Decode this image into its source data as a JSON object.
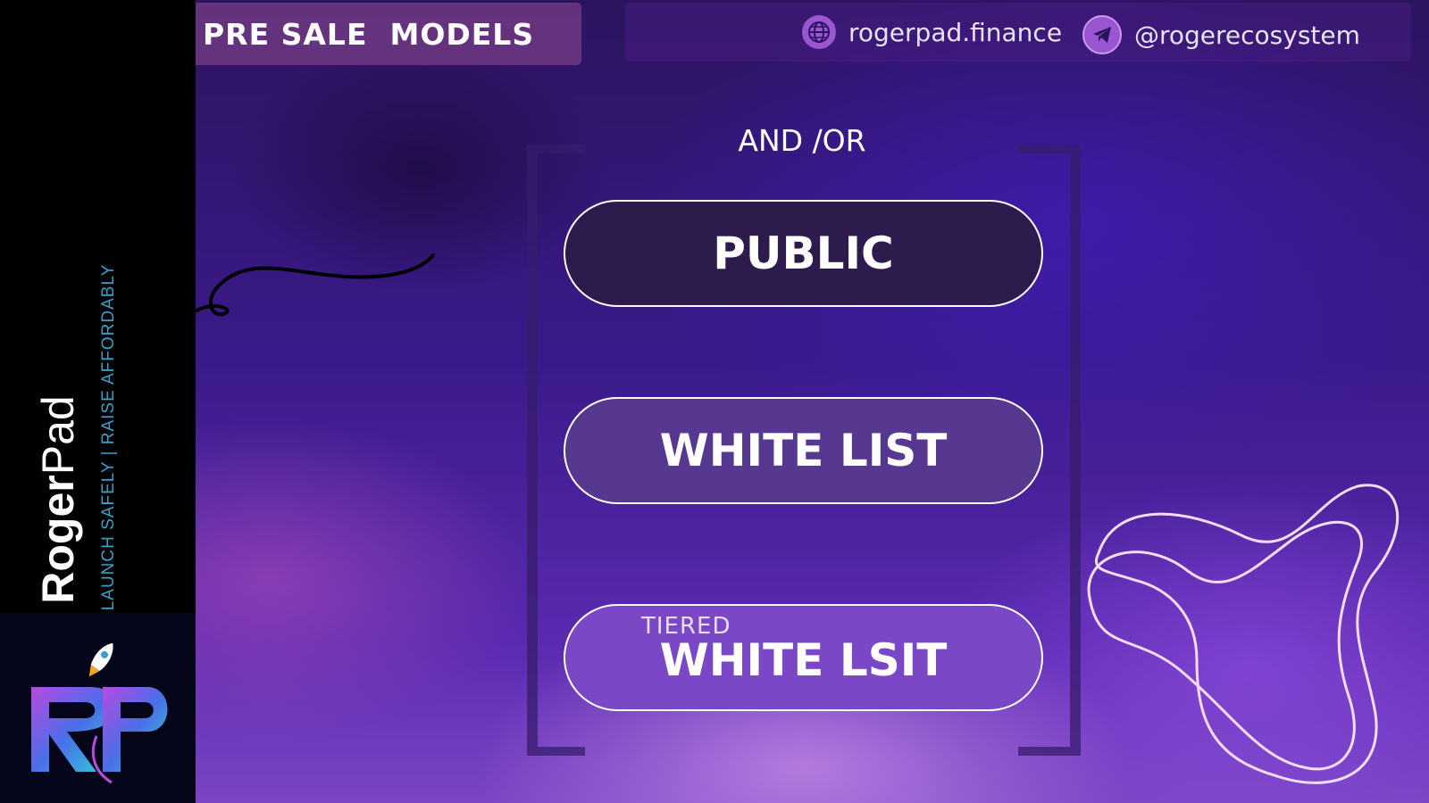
{
  "sidebar": {
    "brand_bold": "Roger",
    "brand_light": "Pad",
    "tagline": "LAUNCH SAFELY | RAISE AFFORDABLY",
    "logo_text": "RP"
  },
  "header": {
    "title": "PRE SALE  MODELS",
    "website": "rogerpad.finance",
    "telegram": "@rogerecosystem"
  },
  "main": {
    "connector": "AND /OR",
    "options": [
      {
        "label": "PUBLIC"
      },
      {
        "label": "WHITE LIST"
      },
      {
        "prefix": "TIERED",
        "label": "WHITE LSIT"
      }
    ]
  },
  "colors": {
    "accent_purple": "#9a55d0",
    "tagline_blue": "#3a9fc7",
    "pill_dark": "#2e1b4d",
    "pill_mid": "#573891",
    "pill_light": "#7a48c7"
  },
  "icons": [
    "globe-icon",
    "telegram-icon",
    "rocket-icon"
  ]
}
